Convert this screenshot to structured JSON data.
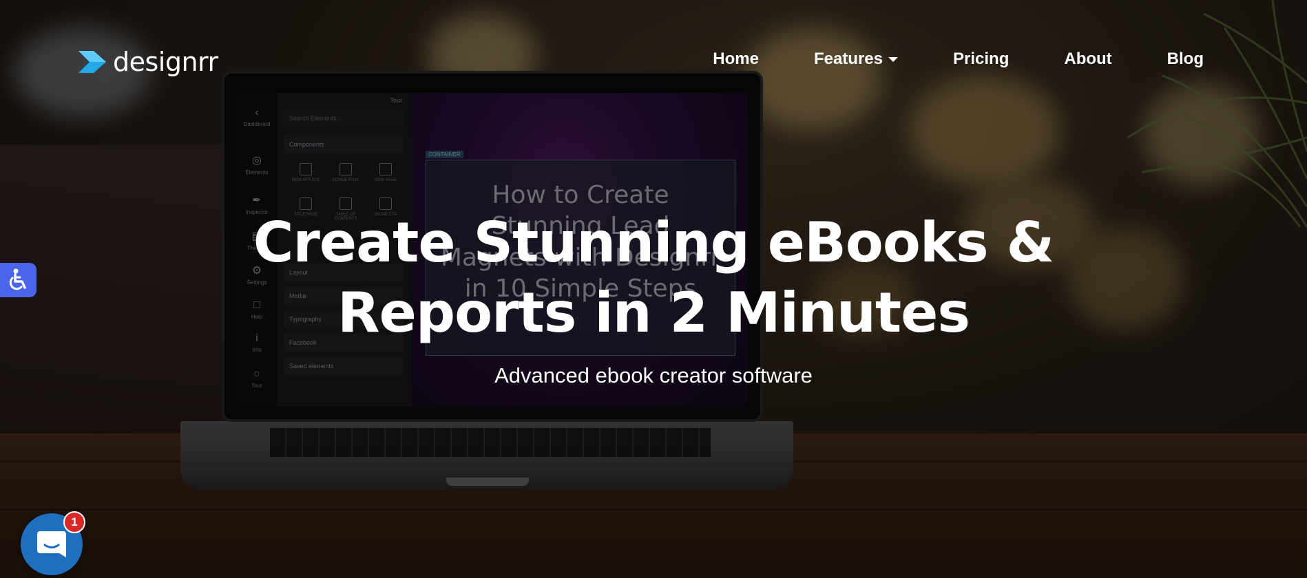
{
  "brand": {
    "name": "designrr",
    "accent": "#23a8e8"
  },
  "nav": {
    "items": [
      {
        "label": "Home"
      },
      {
        "label": "Features",
        "has_dropdown": true
      },
      {
        "label": "Pricing"
      },
      {
        "label": "About"
      },
      {
        "label": "Blog"
      }
    ]
  },
  "hero": {
    "title_line1": "Create Stunning eBooks &",
    "title_line2": "Reports in 2 Minutes",
    "subtitle": "Advanced ebook creator software"
  },
  "laptop_screen": {
    "tour_label": "Tour",
    "search_placeholder": "Search Elements...",
    "rail": [
      "Dashboard",
      "Elements",
      "Inspector",
      "Themes",
      "Settings",
      "Help",
      "Info",
      "Tour"
    ],
    "sections": [
      "Components",
      "Layout",
      "Media",
      "Typography",
      "Facebook",
      "Saved elements"
    ],
    "components": [
      "NEW ARTICLE",
      "COVER PAGE",
      "NEW PAGE",
      "TITLE PAGE",
      "TABLE OF CONTENTS",
      "INLINE CTA"
    ],
    "container_tag": "CONTAINER",
    "book_line1": "How to Create",
    "book_line2": "Stunning Lead",
    "book_line3": "Magnets with Designrr",
    "book_line4": "in 10 Simple Steps"
  },
  "widgets": {
    "accessibility_icon": "wheelchair-icon",
    "chat_icon": "chat-bubble-icon",
    "chat_badge_count": "1",
    "accessibility_color": "#4a65ea",
    "chat_color": "#1f6fbf",
    "badge_color": "#d92828"
  }
}
